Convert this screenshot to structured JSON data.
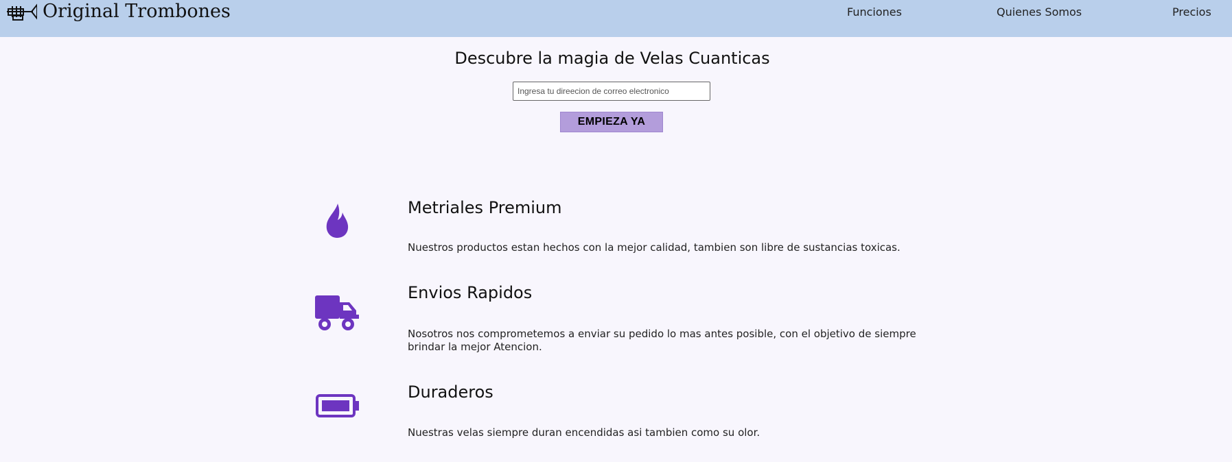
{
  "header": {
    "brand_name": "Original Trombones",
    "logo_icon": "trombone-logo-icon",
    "nav": [
      {
        "label": "Funciones"
      },
      {
        "label": "Quienes Somos"
      },
      {
        "label": "Precios"
      }
    ]
  },
  "hero": {
    "title": "Descubre la magia de Velas Cuanticas",
    "email_placeholder": "Ingresa tu direecion de correo electronico",
    "email_value": "",
    "cta_label": "EMPIEZA YA"
  },
  "features": [
    {
      "icon": "flame-icon",
      "title": "Metriales Premium",
      "text": "Nuestros productos estan hechos con la mejor calidad, tambien son libre de sustancias toxicas."
    },
    {
      "icon": "truck-icon",
      "title": "Envios Rapidos",
      "text": "Nosotros nos comprometemos a enviar su pedido lo mas antes posible, con el objetivo de siempre brindar la mejor Atencion."
    },
    {
      "icon": "battery-icon",
      "title": "Duraderos",
      "text": "Nuestras velas siempre duran encendidas asi tambien como su olor."
    }
  ],
  "colors": {
    "header_bg": "#b9cfeb",
    "page_bg": "#f8f6fd",
    "accent": "#6d35c0",
    "cta_bg": "#b39ddb"
  }
}
